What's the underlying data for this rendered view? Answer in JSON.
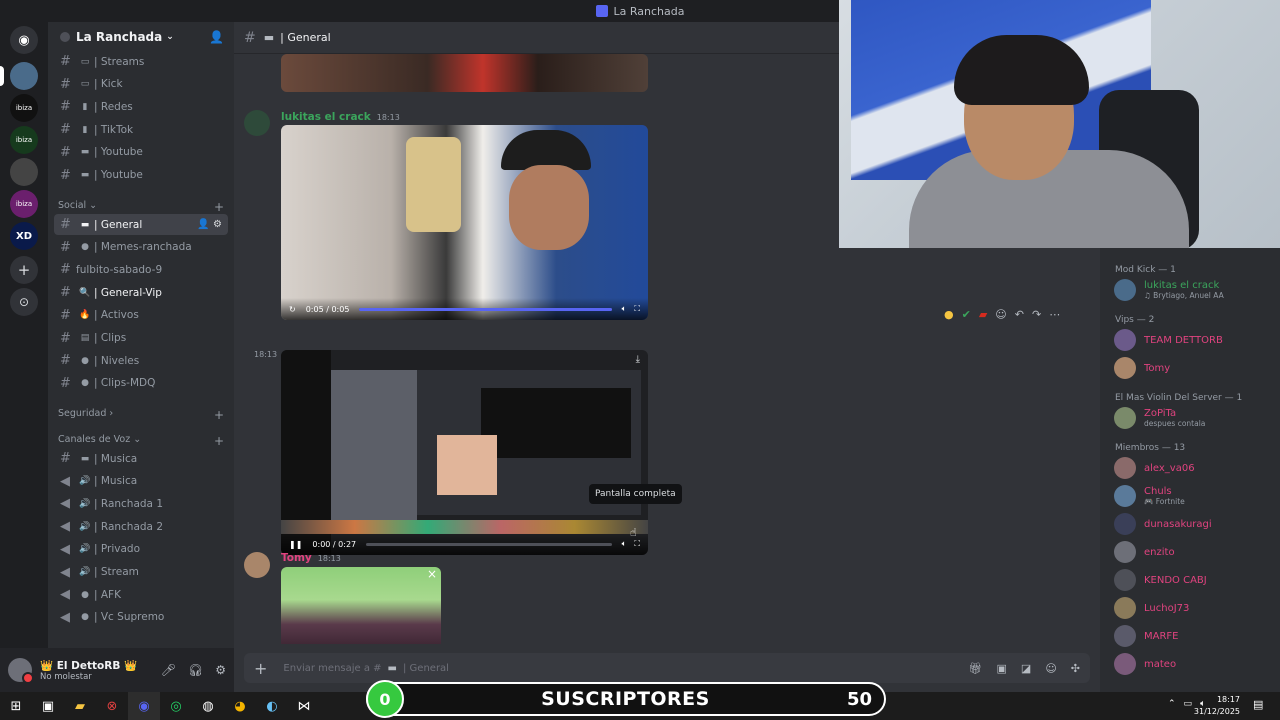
{
  "window": {
    "title": "La Ranchada"
  },
  "server": {
    "name": "La Ranchada"
  },
  "channels_top": [
    {
      "emoji": "▭",
      "label": "| Streams"
    },
    {
      "emoji": "▭",
      "label": "| Kick"
    },
    {
      "emoji": "▮",
      "label": "| Redes"
    },
    {
      "emoji": "▮",
      "label": "| TikTok"
    },
    {
      "emoji": "▬",
      "label": "| Youtube"
    },
    {
      "emoji": "▬",
      "label": "| Youtube"
    }
  ],
  "categories": {
    "social": "Social",
    "seguridad": "Seguridad",
    "voz": "Canales de Voz"
  },
  "channels_social": [
    {
      "emoji": "▬",
      "label": "| General",
      "active": true
    },
    {
      "emoji": "●",
      "label": "| Memes-ranchada"
    },
    {
      "emoji": "",
      "label": "fulbito-sabado-9"
    },
    {
      "emoji": "🔍",
      "label": "| General-Vip"
    },
    {
      "emoji": "🔥",
      "label": "| Activos"
    },
    {
      "emoji": "▤",
      "label": "| Clips"
    },
    {
      "emoji": "●",
      "label": "| Niveles"
    },
    {
      "emoji": "●",
      "label": "| Clips-MDQ"
    }
  ],
  "channels_voice": [
    {
      "icon": "#",
      "emoji": "▬",
      "label": "| Musica"
    },
    {
      "icon": "🔊",
      "emoji": "🔊",
      "label": "| Musica"
    },
    {
      "icon": "🔊",
      "emoji": "🔊",
      "label": "| Ranchada 1"
    },
    {
      "icon": "🔊",
      "emoji": "🔊",
      "label": "| Ranchada 2"
    },
    {
      "icon": "🔊",
      "emoji": "🔊",
      "label": "| Privado"
    },
    {
      "icon": "🔊",
      "emoji": "🔊",
      "label": "| Stream"
    },
    {
      "icon": "🔊",
      "emoji": "●",
      "label": "| AFK"
    },
    {
      "icon": "🔊",
      "emoji": "●",
      "label": "| Vc Supremo"
    }
  ],
  "user": {
    "name": "👑 El DettoRB 👑",
    "status": "No molestar"
  },
  "header": {
    "channel": "| General"
  },
  "messages": [
    {
      "author": "lukitas el crack",
      "time": "18:13",
      "video_time": "0:05 / 0:05",
      "video_progress": 1.0
    },
    {
      "time": "18:13",
      "video_time": "0:00 / 0:27",
      "video_progress": 0.0,
      "tooltip": "Pantalla completa"
    },
    {
      "author": "Tomy",
      "time": "18:13"
    }
  ],
  "composer": {
    "placeholder": "Enviar mensaje a #",
    "channel": "| General"
  },
  "members": {
    "groups": [
      {
        "title": "Mod Kick — 1",
        "items": [
          {
            "name": "lukitas el crack",
            "sub": "♫ Brytiago, Anuel AA",
            "color": "#3ba55c"
          }
        ]
      },
      {
        "title": "Vips — 2",
        "items": [
          {
            "name": "TEAM DETTORB",
            "sub": "",
            "color": "#e0437f"
          },
          {
            "name": "Tomy",
            "sub": "",
            "color": "#e0437f"
          }
        ]
      },
      {
        "title": "El Mas Violin Del Server — 1",
        "items": [
          {
            "name": "ZoPiTa",
            "sub": "despues contala",
            "color": "#e0437f"
          }
        ]
      },
      {
        "title": "Miembros — 13",
        "items": [
          {
            "name": "alex_va06",
            "sub": "",
            "color": "#e0437f"
          },
          {
            "name": "Chuls",
            "sub": "🎮 Fortnite",
            "color": "#e0437f"
          },
          {
            "name": "dunasakuragi",
            "sub": "",
            "color": "#e0437f"
          },
          {
            "name": "enzito",
            "sub": "",
            "color": "#e0437f"
          },
          {
            "name": "KENDO CABJ",
            "sub": "",
            "color": "#e0437f"
          },
          {
            "name": "LuchoJ73",
            "sub": "",
            "color": "#e0437f"
          },
          {
            "name": "MARFE",
            "sub": "",
            "color": "#e0437f"
          },
          {
            "name": "mateo",
            "sub": "",
            "color": "#e0437f"
          }
        ]
      }
    ]
  },
  "overlay": {
    "subs_count": "0",
    "subs_label": "SUSCRIPTORES",
    "subs_goal": "50"
  },
  "clock": {
    "time": "18:17",
    "date": "31/12/2025"
  },
  "colors": {
    "accent": "#5865f2",
    "mod": "#3ba55c",
    "vip": "#e0437f"
  }
}
